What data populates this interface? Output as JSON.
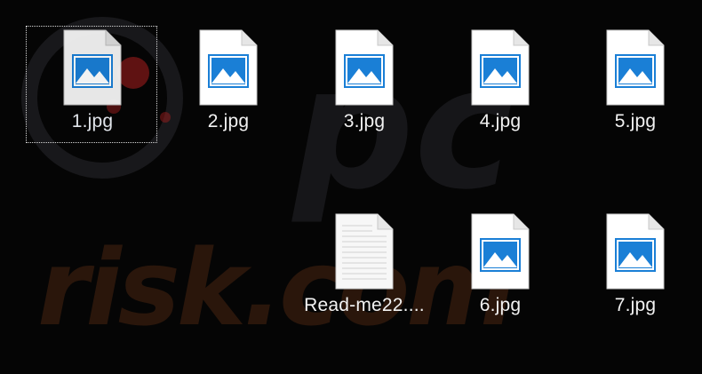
{
  "window": {
    "view": "Large icons"
  },
  "watermark": {
    "text": "risk.com"
  },
  "files": [
    {
      "name": "1.jpg",
      "type": "image",
      "selected": true
    },
    {
      "name": "2.jpg",
      "type": "image",
      "selected": false
    },
    {
      "name": "3.jpg",
      "type": "image",
      "selected": false
    },
    {
      "name": "4.jpg",
      "type": "image",
      "selected": false
    },
    {
      "name": "5.jpg",
      "type": "image",
      "selected": false
    },
    {
      "name": "Read-me22....",
      "type": "text",
      "selected": false
    },
    {
      "name": "6.jpg",
      "type": "image",
      "selected": false
    },
    {
      "name": "7.jpg",
      "type": "image",
      "selected": false
    }
  ],
  "colors": {
    "background": "#050505",
    "image_icon_blue": "#1a7fd6",
    "page_white": "#ffffff",
    "selection_border": "#d8d8d8"
  }
}
